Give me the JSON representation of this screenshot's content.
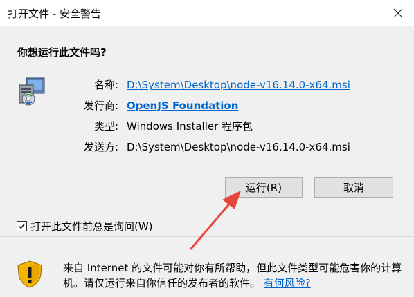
{
  "window": {
    "title": "打开文件 - 安全警告"
  },
  "question": "你想运行此文件吗?",
  "fields": [
    {
      "label": "名称:",
      "value": "D:\\System\\Desktop\\node-v16.14.0-x64.msi"
    },
    {
      "label": "发行商:",
      "value": "OpenJS Foundation"
    },
    {
      "label": "类型:",
      "value": "Windows Installer 程序包"
    },
    {
      "label": "发送方:",
      "value": "D:\\System\\Desktop\\node-v16.14.0-x64.msi"
    }
  ],
  "buttons": {
    "run": "运行(R)",
    "cancel": "取消"
  },
  "checkbox": {
    "label": "打开此文件前总是询问(W)",
    "checked": true
  },
  "footer": {
    "text": "来自 Internet 的文件可能对你有所帮助，但此文件类型可能危害你的计算机。请仅运行来自你信任的发布者的软件。",
    "link": "有何风险?"
  },
  "colors": {
    "link": "#0066cc",
    "arrow": "#e8453c",
    "shield": "#f5b400"
  },
  "icons": [
    "close-icon",
    "installer-icon",
    "shield-warning-icon",
    "checkmark-icon"
  ]
}
